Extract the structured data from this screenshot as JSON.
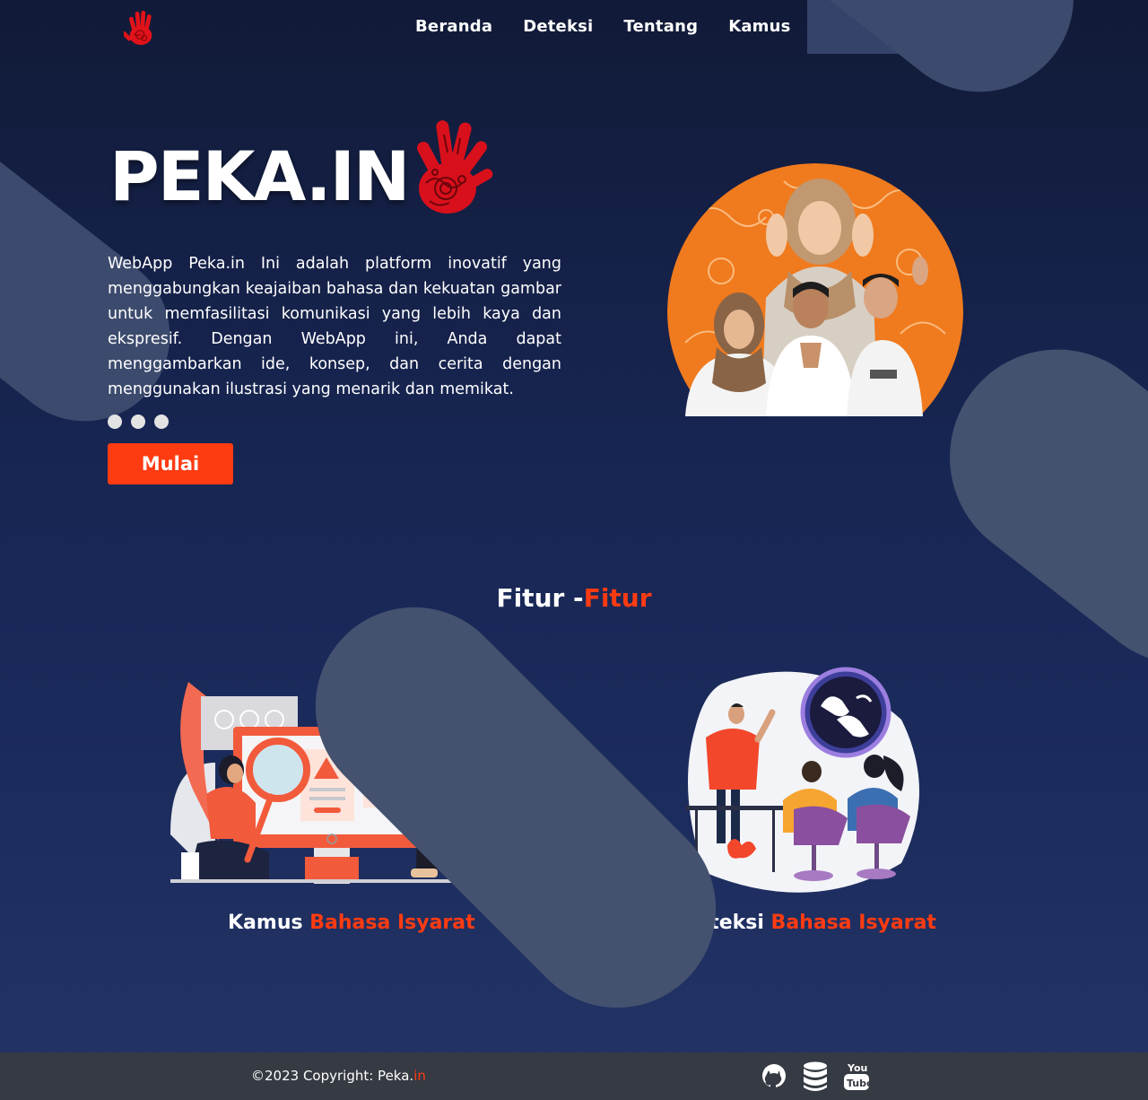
{
  "nav": {
    "logo_icon": "hand-logo-icon",
    "links": [
      "Beranda",
      "Deteksi",
      "Tentang",
      "Kamus"
    ]
  },
  "hero": {
    "title": "PEKA.IN",
    "title_icon": "red-batik-hand-icon",
    "description": "WebApp Peka.in Ini adalah platform inovatif yang menggabungkan keajaiban bahasa dan kekuatan gambar untuk memfasilitasi komunikasi yang lebih kaya dan ekspresif. Dengan WebApp ini, Anda dapat menggambarkan ide, konsep, dan cerita dengan menggunakan ilustrasi yang menarik dan memikat.",
    "carousel_dots": 3,
    "button_label": "Mulai"
  },
  "features": {
    "title_main": "Fitur -",
    "title_accent": "Fitur",
    "cards": [
      {
        "title_main": "Kamus ",
        "title_accent": "Bahasa Isyarat",
        "illustration": "magnifier-search-illustration"
      },
      {
        "title_main": "Deteksi ",
        "title_accent": "Bahasa Isyarat",
        "illustration": "sign-language-class-illustration"
      }
    ]
  },
  "footer": {
    "copyright_main": "©2023 Copyright: Peka.",
    "copyright_accent": "in",
    "icons": [
      "github-icon",
      "database-icon",
      "youtube-icon"
    ]
  },
  "colors": {
    "accent": "#ff3b12",
    "background": "#172552",
    "footer": "#353a43"
  }
}
